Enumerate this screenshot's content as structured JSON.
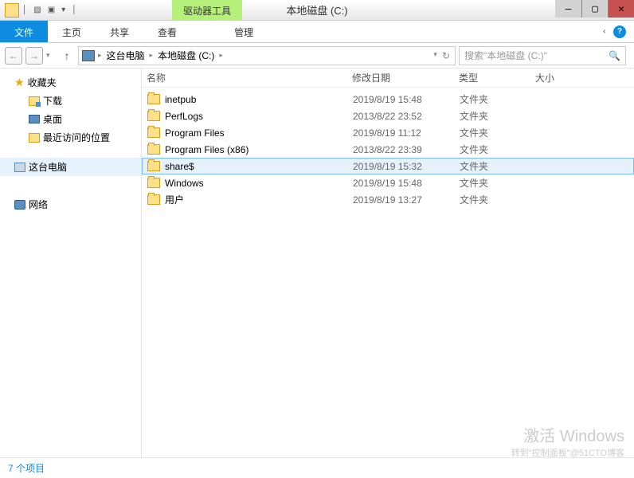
{
  "titlebar": {
    "highlight_tab": "驱动器工具",
    "window_title": "本地磁盘 (C:)"
  },
  "ribbon": {
    "file": "文件",
    "tabs": [
      "主页",
      "共享",
      "查看"
    ],
    "manage": "管理"
  },
  "address": {
    "segments": [
      "这台电脑",
      "本地磁盘 (C:)"
    ],
    "search_placeholder": "搜索\"本地磁盘 (C:)\""
  },
  "nav": {
    "favorites": "收藏夹",
    "fav_items": [
      "下载",
      "桌面",
      "最近访问的位置"
    ],
    "this_pc": "这台电脑",
    "network": "网络"
  },
  "columns": {
    "name": "名称",
    "date": "修改日期",
    "type": "类型",
    "size": "大小"
  },
  "folder_type": "文件夹",
  "files": [
    {
      "name": "inetpub",
      "date": "2019/8/19 15:48"
    },
    {
      "name": "PerfLogs",
      "date": "2013/8/22 23:52"
    },
    {
      "name": "Program Files",
      "date": "2019/8/19 11:12"
    },
    {
      "name": "Program Files (x86)",
      "date": "2013/8/22 23:39"
    },
    {
      "name": "share$",
      "date": "2019/8/19 15:32",
      "selected": true
    },
    {
      "name": "Windows",
      "date": "2019/8/19 15:48"
    },
    {
      "name": "用户",
      "date": "2019/8/19 13:27"
    }
  ],
  "status": "7 个项目",
  "watermark": {
    "line1": "激活 Windows",
    "line2": "转到\"控制面板\"@51CTO博客"
  }
}
